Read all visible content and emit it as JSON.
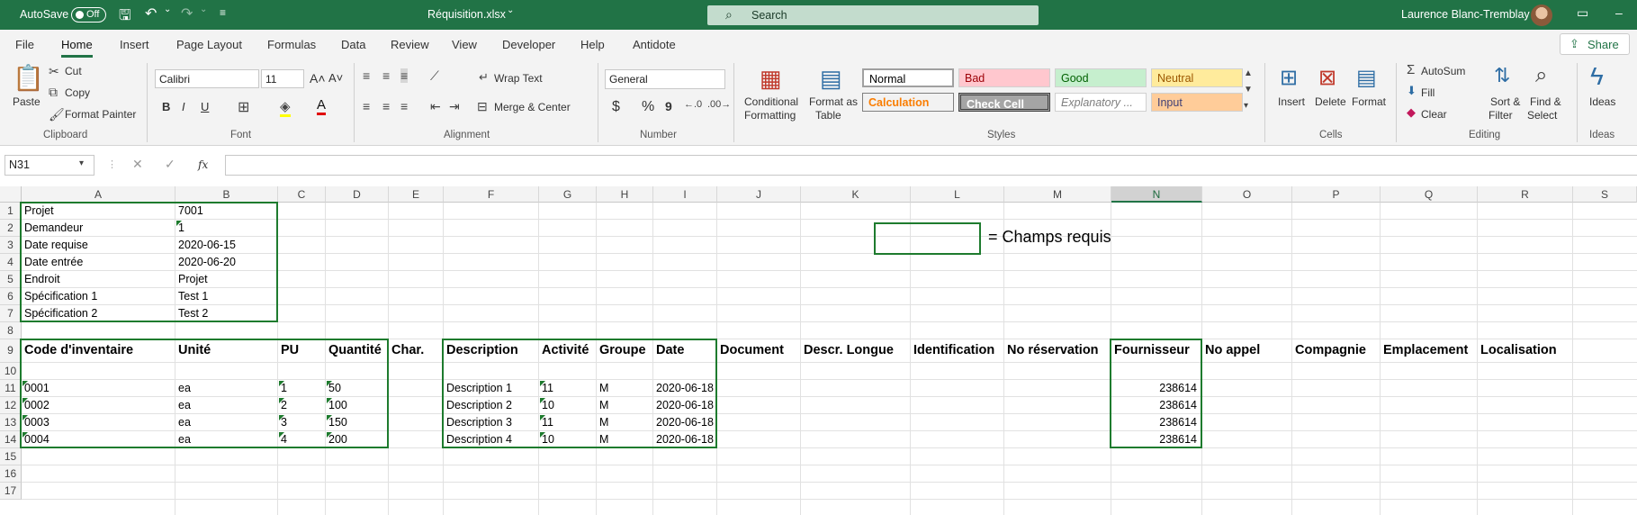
{
  "titlebar": {
    "autosave_label": "AutoSave",
    "autosave_state": "Off",
    "filename": "Réquisition.xlsx",
    "search_label": "Search",
    "user_name": "Laurence Blanc-Tremblay"
  },
  "tabs": [
    "File",
    "Home",
    "Insert",
    "Page Layout",
    "Formulas",
    "Data",
    "Review",
    "View",
    "Developer",
    "Help",
    "Antidote"
  ],
  "active_tab": "Home",
  "share_label": "Share",
  "ribbon": {
    "clipboard": {
      "paste": "Paste",
      "cut": "Cut",
      "copy": "Copy",
      "format_painter": "Format Painter",
      "label": "Clipboard"
    },
    "font": {
      "name": "Calibri",
      "size": "11",
      "bold": "B",
      "italic": "I",
      "underline": "U",
      "label": "Font"
    },
    "alignment": {
      "wrap_text": "Wrap Text",
      "merge_center": "Merge & Center",
      "label": "Alignment"
    },
    "number": {
      "format": "General",
      "currency": "$",
      "percent": "%",
      "comma": "9",
      "label": "Number"
    },
    "styles": {
      "conditional_formatting": [
        "Conditional",
        "Formatting"
      ],
      "format_as_table": [
        "Format as",
        "Table"
      ],
      "cells": [
        {
          "name": "Normal",
          "bg": "#ffffff",
          "fg": "#000000"
        },
        {
          "name": "Bad",
          "bg": "#ffc7ce",
          "fg": "#9c0006"
        },
        {
          "name": "Good",
          "bg": "#c6efce",
          "fg": "#006100"
        },
        {
          "name": "Neutral",
          "bg": "#ffeb9c",
          "fg": "#9c5700"
        },
        {
          "name": "Calculation",
          "bg": "#f2f2f2",
          "fg": "#fa7d00"
        },
        {
          "name": "Check Cell",
          "bg": "#a5a5a5",
          "fg": "#ffffff"
        },
        {
          "name": "Explanatory ...",
          "bg": "#ffffff",
          "fg": "#7f7f7f"
        },
        {
          "name": "Input",
          "bg": "#ffcc99",
          "fg": "#3f3f76"
        }
      ],
      "label": "Styles"
    },
    "cells_group": {
      "insert": "Insert",
      "delete": "Delete",
      "format": "Format",
      "label": "Cells"
    },
    "editing": {
      "autosum": "AutoSum",
      "fill": "Fill",
      "clear": "Clear",
      "sort_filter": [
        "Sort &",
        "Filter"
      ],
      "find_select": [
        "Find &",
        "Select"
      ],
      "label": "Editing"
    },
    "ideas": {
      "ideas": "Ideas",
      "label": "Ideas"
    }
  },
  "formula_bar": {
    "name_box": "N31",
    "fx": "fx",
    "value": ""
  },
  "columns": [
    {
      "name": "A",
      "w": 171
    },
    {
      "name": "B",
      "w": 114
    },
    {
      "name": "C",
      "w": 53
    },
    {
      "name": "D",
      "w": 70
    },
    {
      "name": "E",
      "w": 61
    },
    {
      "name": "F",
      "w": 106
    },
    {
      "name": "G",
      "w": 64
    },
    {
      "name": "H",
      "w": 63
    },
    {
      "name": "I",
      "w": 71
    },
    {
      "name": "J",
      "w": 93
    },
    {
      "name": "K",
      "w": 122
    },
    {
      "name": "L",
      "w": 104
    },
    {
      "name": "M",
      "w": 119
    },
    {
      "name": "N",
      "w": 101
    },
    {
      "name": "O",
      "w": 100
    },
    {
      "name": "P",
      "w": 98
    },
    {
      "name": "Q",
      "w": 108
    },
    {
      "name": "R",
      "w": 106
    },
    {
      "name": "S",
      "w": 164
    }
  ],
  "selected_column": "N",
  "rows": [
    "1",
    "2",
    "3",
    "4",
    "5",
    "6",
    "7",
    "8",
    "9",
    "10",
    "11",
    "12",
    "13",
    "14",
    "15",
    "16",
    "17",
    "18"
  ],
  "header_info": [
    {
      "label": "Projet",
      "value": "7001"
    },
    {
      "label": "Demandeur",
      "value": "1"
    },
    {
      "label": "Date requise",
      "value": "2020-06-15"
    },
    {
      "label": "Date entrée",
      "value": "2020-06-20"
    },
    {
      "label": "Endroit",
      "value": "Projet"
    },
    {
      "label": "Spécification 1",
      "value": "Test 1"
    },
    {
      "label": "Spécification 2",
      "value": "Test 2"
    }
  ],
  "legend_text": "= Champs requis",
  "table_headers": {
    "A": "Code d'inventaire",
    "B": "Unité",
    "C": "PU",
    "D": "Quantité",
    "E": "Char.",
    "F": "Description",
    "G": "Activité",
    "H": "Groupe",
    "I": "Date",
    "J": "Document",
    "K": "Descr. Longue",
    "L": "Identification",
    "M": "No réservation",
    "N": "Fournisseur",
    "O": "No appel",
    "P": "Compagnie",
    "Q": "Emplacement",
    "R": "Localisation"
  },
  "table_rows": [
    {
      "code": "0001",
      "unite": "ea",
      "pu": "1",
      "qte": "50",
      "desc": "Description 1",
      "act": "11",
      "grp": "M",
      "date": "2020-06-18",
      "fourn": "238614"
    },
    {
      "code": "0002",
      "unite": "ea",
      "pu": "2",
      "qte": "100",
      "desc": "Description 2",
      "act": "10",
      "grp": "M",
      "date": "2020-06-18",
      "fourn": "238614"
    },
    {
      "code": "0003",
      "unite": "ea",
      "pu": "3",
      "qte": "150",
      "desc": "Description 3",
      "act": "11",
      "grp": "M",
      "date": "2020-06-18",
      "fourn": "238614"
    },
    {
      "code": "0004",
      "unite": "ea",
      "pu": "4",
      "qte": "200",
      "desc": "Description 4",
      "act": "10",
      "grp": "M",
      "date": "2020-06-18",
      "fourn": "238614"
    }
  ],
  "colors": {
    "excel_green": "#217346",
    "required_border": "#1e7b2e"
  }
}
